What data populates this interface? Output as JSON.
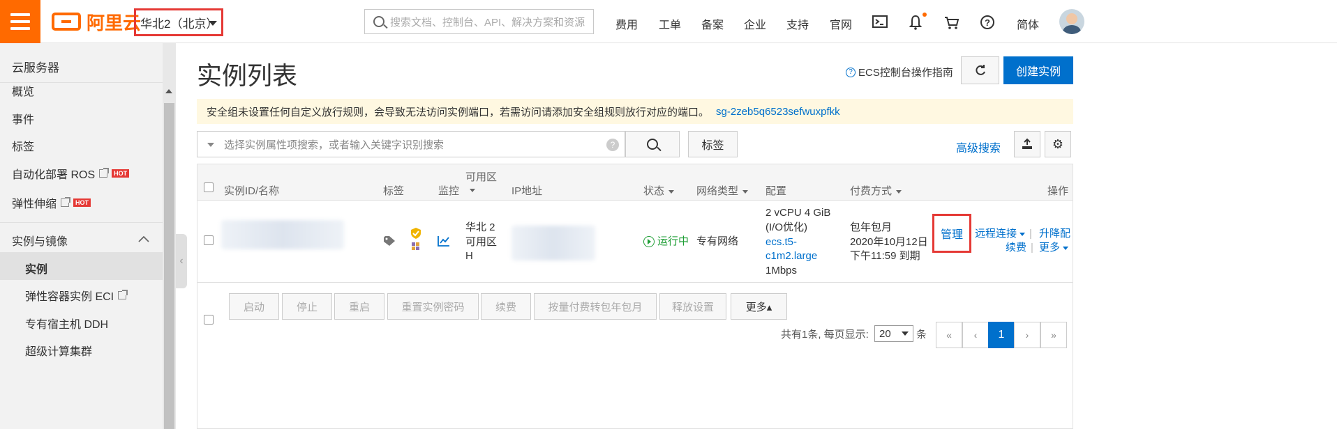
{
  "topbar": {
    "brand": "阿里云",
    "region": "华北2（北京）",
    "search_placeholder": "搜索文档、控制台、API、解决方案和资源",
    "nav": [
      "费用",
      "工单",
      "备案",
      "企业",
      "支持",
      "官网"
    ],
    "lang": "简体"
  },
  "sidebar": {
    "title": "云服务器",
    "items": [
      {
        "label": "概览"
      },
      {
        "label": "事件"
      },
      {
        "label": "标签"
      },
      {
        "label": "自动化部署 ROS",
        "badge": "HOT"
      },
      {
        "label": "弹性伸缩",
        "badge": "HOT"
      }
    ],
    "section": "实例与镜像",
    "sub_items": [
      {
        "label": "实例"
      },
      {
        "label": "弹性容器实例 ECI"
      },
      {
        "label": "专有宿主机 DDH"
      },
      {
        "label": "超级计算集群"
      }
    ]
  },
  "main": {
    "title": "实例列表",
    "guide": "ECS控制台操作指南",
    "create_button": "创建实例",
    "alert_text": "安全组未设置任何自定义放行规则，会导致无法访问实例端口，若需访问请添加安全组规则放行对应的端口。",
    "alert_link": "sg-2zeb5q6523sefwuxpfkk",
    "filter_placeholder": "选择实例属性项搜索，或者输入关键字识别搜索",
    "tag_button": "标签",
    "advanced_search": "高级搜索"
  },
  "table": {
    "headers": {
      "id": "实例ID/名称",
      "tag": "标签",
      "monitor": "监控",
      "zone": "可用区",
      "ip": "IP地址",
      "status": "状态",
      "network": "网络类型",
      "config": "配置",
      "billing": "付费方式",
      "actions": "操作"
    },
    "row": {
      "zone": [
        "华北 2",
        "可用区",
        "H"
      ],
      "status": "运行中",
      "network": "专有网络",
      "config_line1": "2 vCPU 4 GiB",
      "config_line2": "(I/O优化)",
      "instance_type_1": "ecs.t5-",
      "instance_type_2": "c1m2.large",
      "bandwidth": "1Mbps",
      "billing_1": "包年包月",
      "billing_2": "2020年10月12日",
      "billing_3": "下午11:59 到期",
      "manage": "管理",
      "remote": "远程连接",
      "resize": "升降配",
      "renew": "续费",
      "more": "更多"
    }
  },
  "bulk_actions": [
    "启动",
    "停止",
    "重启",
    "重置实例密码",
    "续费",
    "按量付费转包年包月",
    "释放设置"
  ],
  "bulk_more": "更多▴",
  "pagination": {
    "total_text": "共有1条, 每页显示:",
    "page_size": "20",
    "unit": "条",
    "first": "«",
    "prev": "‹",
    "current": "1",
    "next": "›",
    "last": "»"
  }
}
